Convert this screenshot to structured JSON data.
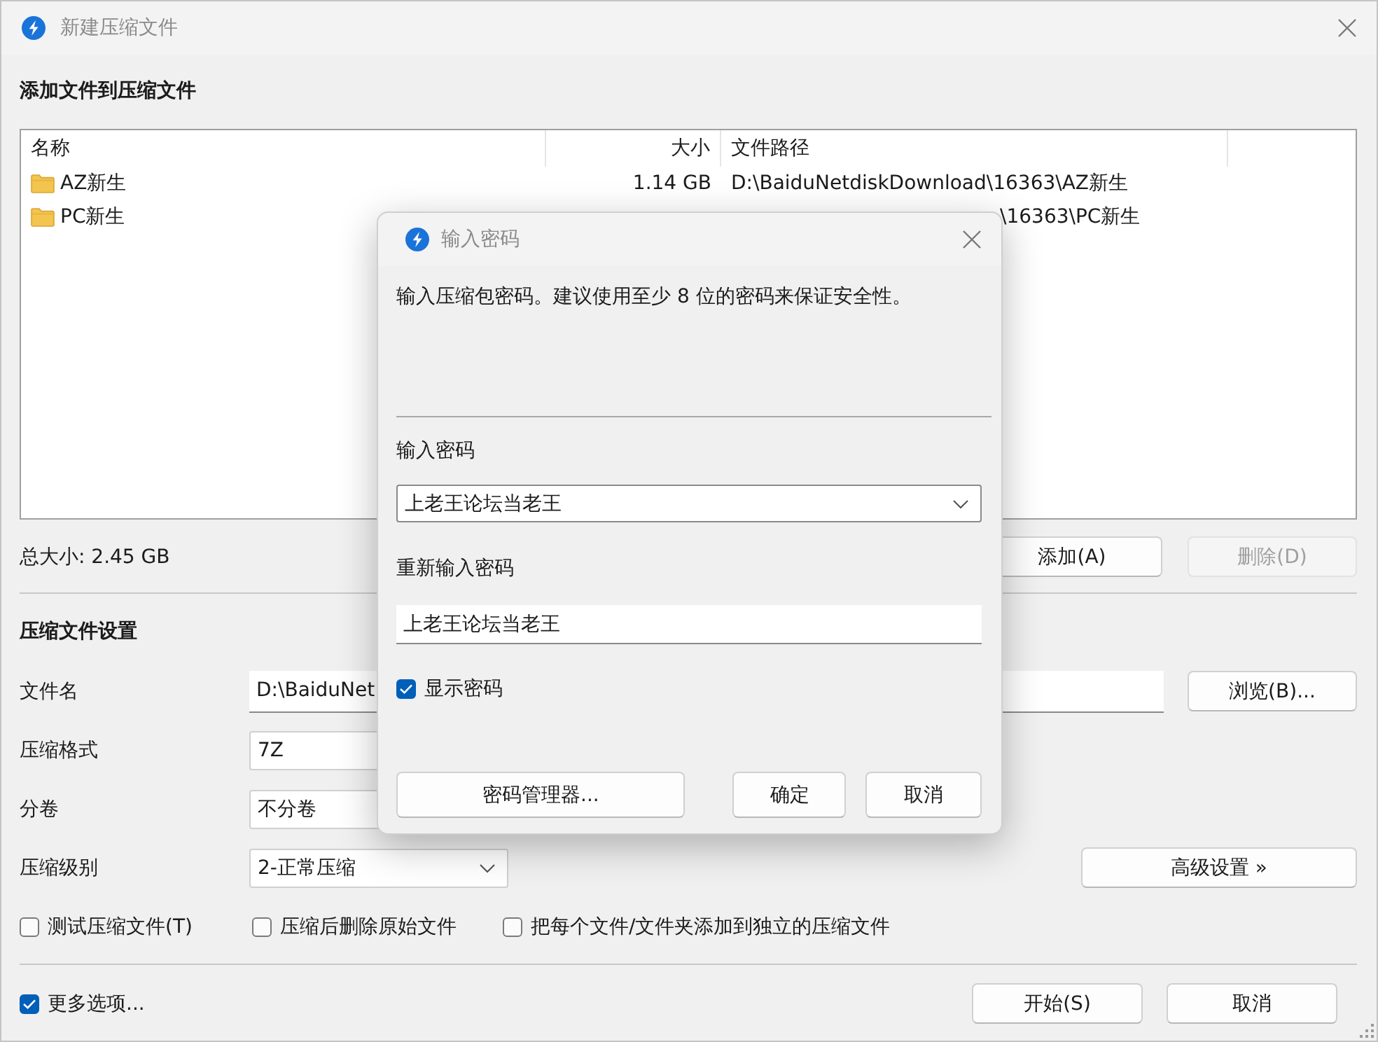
{
  "window": {
    "title": "新建压缩文件"
  },
  "files": {
    "heading": "添加文件到压缩文件",
    "columns": [
      "名称",
      "大小",
      "文件路径"
    ],
    "rows": [
      {
        "name": "AZ新生",
        "size": "1.14 GB",
        "path": "D:\\BaiduNetdiskDownload\\16363\\AZ新生"
      },
      {
        "name": "PC新生",
        "path": "\\16363\\PC新生"
      }
    ],
    "total": "总大小: 2.45 GB",
    "buttons": [
      {
        "label": "添加(A)",
        "disabled": false
      },
      {
        "label": "删除(D)",
        "disabled": true
      }
    ]
  },
  "settings": {
    "heading": "压缩文件设置",
    "fields": [
      {
        "kind": "text",
        "label": "文件名",
        "value": "D:\\BaiduNet",
        "button": "浏览(B)..."
      },
      {
        "kind": "box",
        "label": "压缩格式",
        "value": "7Z"
      },
      {
        "kind": "box",
        "label": "分卷",
        "value": "不分卷"
      },
      {
        "kind": "dropdown",
        "label": "压缩级别",
        "value": "2-正常压缩",
        "button": "高级设置 »"
      }
    ],
    "options": [
      {
        "label": "测试压缩文件(T)",
        "checked": false
      },
      {
        "label": "压缩后删除原始文件",
        "checked": false
      },
      {
        "label": "把每个文件/文件夹添加到独立的压缩文件",
        "checked": false
      }
    ]
  },
  "more_options": {
    "label": "更多选项...",
    "checked": true
  },
  "buttons": [
    "开始(S)",
    "取消"
  ],
  "dialog": {
    "title": "输入密码",
    "message": "输入压缩包密码。建议使用至少 8 位的密码来保证安全性。",
    "password_label": "输入密码",
    "password": "上老王论坛当老王",
    "confirm_label": "重新输入密码",
    "confirm": "上老王论坛当老王",
    "show_password": {
      "label": "显示密码",
      "checked": true
    },
    "buttons": [
      "密码管理器...",
      "确定",
      "取消"
    ]
  }
}
